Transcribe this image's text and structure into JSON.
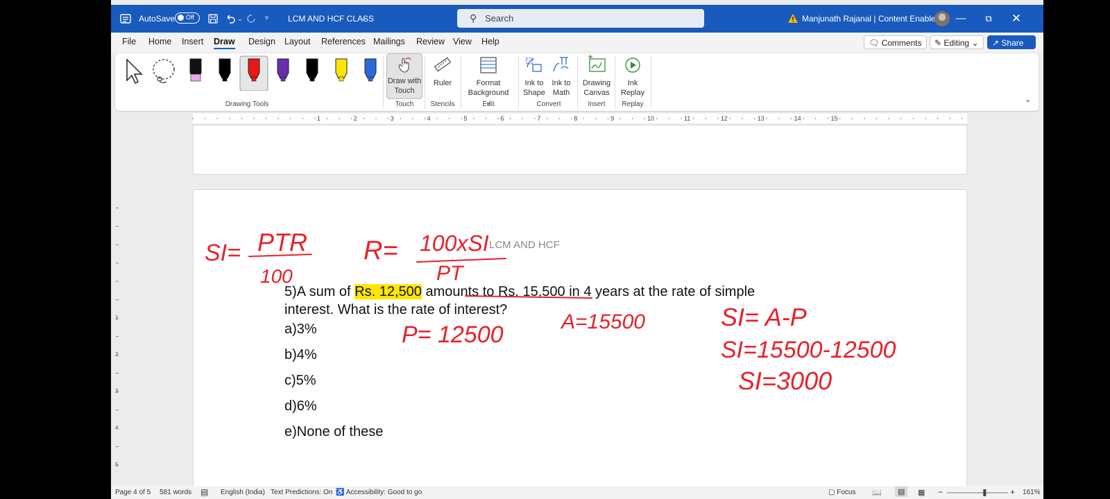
{
  "titlebar": {
    "autosave_label": "AutoSave",
    "autosave_state": "Off",
    "doc_title": "LCM AND HCF CLASS",
    "search_placeholder": "Search",
    "user": "Manjunath Rajanal | Content Enablers"
  },
  "menu": [
    "File",
    "Home",
    "Insert",
    "Draw",
    "Design",
    "Layout",
    "References",
    "Mailings",
    "Review",
    "View",
    "Help"
  ],
  "menu_active": "Draw",
  "menu_right": {
    "comments": "Comments",
    "editing": "Editing",
    "share": "Share"
  },
  "ribbon": {
    "draw_with_touch": [
      "Draw with",
      "Touch"
    ],
    "ruler": "Ruler",
    "format_background": [
      "Format",
      "Background"
    ],
    "ink_to_shape": [
      "Ink to",
      "Shape"
    ],
    "ink_to_math": [
      "Ink to",
      "Math"
    ],
    "drawing_canvas": [
      "Drawing",
      "Canvas"
    ],
    "ink_replay": [
      "Ink",
      "Replay"
    ],
    "groups": {
      "drawing_tools": "Drawing Tools",
      "touch": "Touch",
      "stencils": "Stencils",
      "edit": "Edit",
      "convert": "Convert",
      "insert": "Insert",
      "replay": "Replay"
    },
    "pen_colors": [
      "#f2a6e8",
      "#000000",
      "#e81818",
      "#6a2eb0",
      "#000000",
      "#ffe600",
      "#2a6ad8"
    ]
  },
  "ruler_numbers": [
    "1",
    "2",
    "3",
    "4",
    "5",
    "6",
    "7",
    "8",
    "9",
    "10",
    "11",
    "12",
    "13",
    "14",
    "15"
  ],
  "vruler_numbers": [
    "1",
    "2",
    "3",
    "4",
    "5"
  ],
  "document": {
    "header": "LCM AND HCF",
    "question_before": "5)A sum of ",
    "question_highlight": "Rs. 12,500",
    "question_after": " amounts to Rs. 15,500 in 4 years at the rate of simple",
    "question_line2": "interest. What is the rate of interest?",
    "options": [
      "a)3%",
      "b)4%",
      "c)5%",
      "d)6%",
      "e)None of these"
    ]
  },
  "ink": {
    "si_formula_lhs": "SI=",
    "si_formula_num": "PTR",
    "si_formula_den": "100",
    "r_formula_lhs": "R=",
    "r_formula_num": "100xSI",
    "r_formula_den": "PT",
    "p_value": "P= 12500",
    "a_value": "A=15500",
    "si_eq1": "SI= A-P",
    "si_eq2": "SI=15500-12500",
    "si_eq3": "SI=3000",
    "color": "#e8202a"
  },
  "status": {
    "page": "Page 4 of 5",
    "words": "581 words",
    "language": "English (India)",
    "text_predictions": "Text Predictions: On",
    "accessibility": "Accessibility: Good to go",
    "focus": "Focus",
    "zoom": "161%"
  }
}
